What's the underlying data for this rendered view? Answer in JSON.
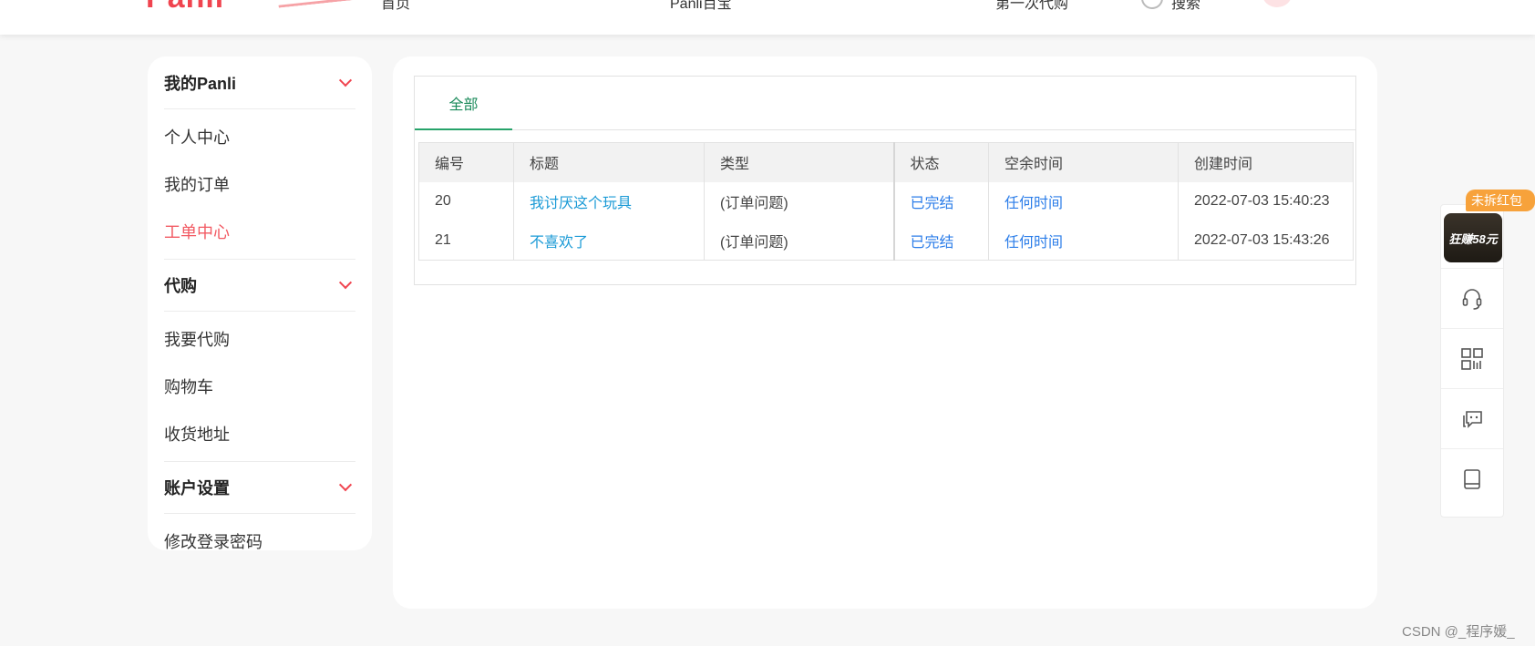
{
  "header": {
    "logo": "Panli",
    "nav": [
      "首页",
      "Panli百宝",
      "第一次代购",
      "搜索"
    ]
  },
  "sidebar": {
    "groups": [
      {
        "title": "我的Panli",
        "items": [
          "个人中心",
          "我的订单",
          "工单中心"
        ]
      },
      {
        "title": "代购",
        "items": [
          "我要代购",
          "购物车",
          "收货地址"
        ]
      },
      {
        "title": "账户设置",
        "items": [
          "修改登录密码"
        ]
      }
    ],
    "active_item": "工单中心",
    "accent_color": "#f25a63"
  },
  "tabs": [
    "全部"
  ],
  "table": {
    "headers": [
      "编号",
      "标题",
      "类型",
      "状态",
      "空余时间",
      "创建时间"
    ],
    "rows": [
      [
        "20",
        "我讨厌这个玩具",
        "(订单问题)",
        "已完结",
        "任何时间",
        "2022-07-03 15:40:23"
      ],
      [
        "21",
        "不喜欢了",
        "(订单问题)",
        "已完结",
        "任何时间",
        "2022-07-03 15:43:26"
      ]
    ]
  },
  "float_bar": {
    "badge": "未拆红包",
    "promo_text": "狂赚58元",
    "icons": [
      "headset-icon",
      "qrcode-icon",
      "chat-icon",
      "tablet-icon"
    ]
  },
  "watermark": "CSDN @_程序媛_"
}
